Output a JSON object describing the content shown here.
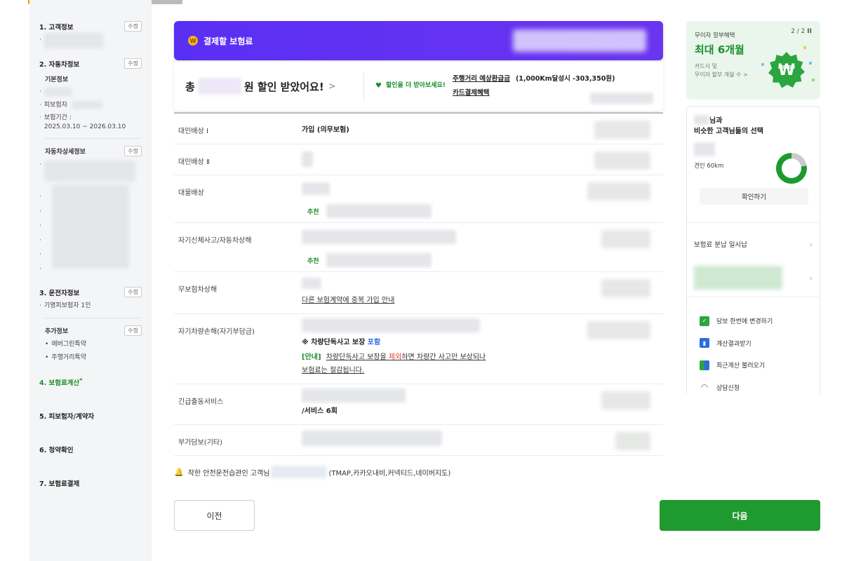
{
  "sidebar": {
    "customer": {
      "title": "1. 고객정보",
      "edit": "수정"
    },
    "vehicle": {
      "title": "2. 자동차정보",
      "edit": "수정",
      "basic_label": "기본정보",
      "insured_label": "피보험자",
      "period_label": "보험기간 :",
      "period_value": "2025.03.10 ~ 2026.03.10",
      "detail_label": "자동차상세정보",
      "detail_edit": "수정"
    },
    "driver": {
      "title": "3. 운전자정보",
      "edit": "수정",
      "item": "기명피보험자 1인"
    },
    "extra": {
      "title": "추가정보",
      "edit": "수정",
      "items": [
        "에버그린특약",
        "주행거리특약"
      ]
    },
    "steps": [
      "4. 보험료계산",
      "5. 피보험자/계약자",
      "6. 청약확인",
      "7. 보험료결제"
    ]
  },
  "banner": {
    "title": "결제할 보험료",
    "coin": "W"
  },
  "discount": {
    "prefix": "총",
    "suffix": "원 할인 받았어요!",
    "chevron": ">",
    "tip": "할인을 더 받아보세요!",
    "mileage_link": "주행거리 예상환급금",
    "mileage_note": "(1,000Km달성시 -303,350원)",
    "card_link": "카드결제혜택"
  },
  "coverage": {
    "r1": {
      "label": "대인배상 Ⅰ",
      "value": "가입 (의무보험)"
    },
    "r2": {
      "label": "대인배상 Ⅱ"
    },
    "r3": {
      "label": "대물배상",
      "rec": "추천"
    },
    "r4": {
      "label": "자기신체사고/자동차상해",
      "rec": "추천"
    },
    "r5": {
      "label": "무보험차상해",
      "link": "다른 보험계약에 중복 가입 안내"
    },
    "r6": {
      "label": "자기차량손해(자기부담금)",
      "note_prefix": "※ 차량단독사고 보장",
      "note_blue": "포함",
      "info_tag": "[안내]",
      "info_a": "차량단독사고 보장을",
      "info_red": "제외",
      "info_b": "하면 차량간 사고만 보상되나",
      "info_c": "보험료는 절감됩니다."
    },
    "r7": {
      "label": "긴급출동서비스",
      "value": "/서비스 6회"
    },
    "r8": {
      "label": "부가담보(기타)"
    }
  },
  "bell": {
    "prefix": "착한 안전운전습관인 고객님",
    "suffix": "(TMAP,카카오내비,커넥티드,네이버지도)"
  },
  "buttons": {
    "prev": "이전",
    "next": "다음"
  },
  "promo": {
    "page": "2 / 2",
    "pause": "II",
    "small": "무이자 할부혜택",
    "big": "최대 6개월",
    "desc1": "카드사 및",
    "desc2": "무이자 할부 개월 수 >",
    "badge": "₩"
  },
  "choice": {
    "name_suffix": "님과",
    "title": "비슷한 고객님들의 선택",
    "km": "견인 60km",
    "confirm": "확인하기",
    "installment": "보험료 분납 일시납"
  },
  "actions": [
    "담보 한번에 변경하기",
    "계산결과받기",
    "최근계산 불러오기",
    "상담신청"
  ],
  "colors": {
    "brand_green": "#1f9a2f",
    "banner_purple": "#5a2ff4",
    "accent_blue": "#2d6ce0",
    "accent_red": "#e23b2e"
  }
}
